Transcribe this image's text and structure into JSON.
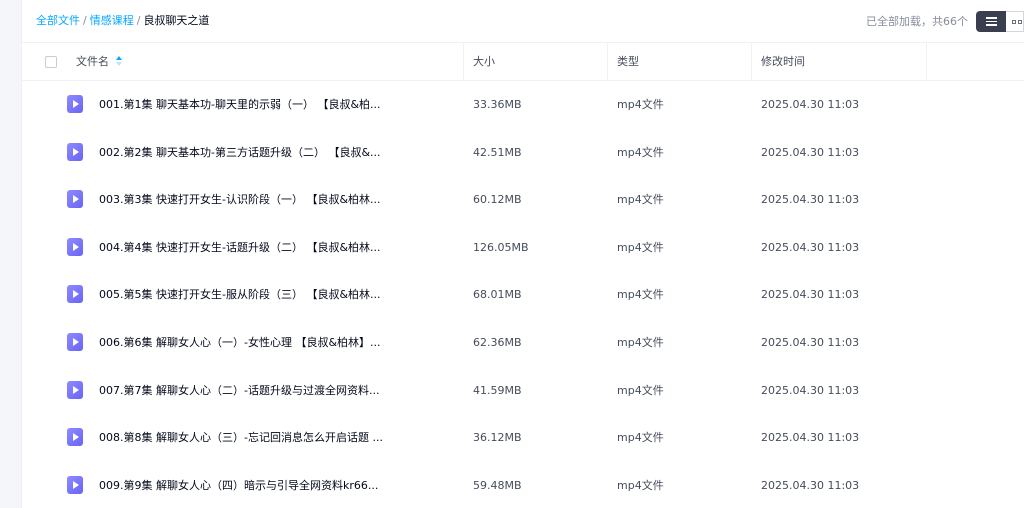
{
  "breadcrumb": {
    "items": [
      "全部文件",
      "情感课程"
    ],
    "separator": "/",
    "current": "良叔聊天之道"
  },
  "status": {
    "load_text": "已全部加载，共66个"
  },
  "view_toggle": {
    "active": "list-icon",
    "inactive": "grid-icon"
  },
  "table": {
    "columns": {
      "name": "文件名",
      "size": "大小",
      "type": "类型",
      "modified": "修改时间"
    },
    "rows": [
      {
        "name": "001.第1集 聊天基本功-聊天里的示弱（一） 【良叔&柏...",
        "size": "33.36MB",
        "type": "mp4文件",
        "modified": "2025.04.30 11:03"
      },
      {
        "name": "002.第2集 聊天基本功-第三方话题升级（二） 【良叔&...",
        "size": "42.51MB",
        "type": "mp4文件",
        "modified": "2025.04.30 11:03"
      },
      {
        "name": "003.第3集 快速打开女生-认识阶段（一） 【良叔&柏林...",
        "size": "60.12MB",
        "type": "mp4文件",
        "modified": "2025.04.30 11:03"
      },
      {
        "name": "004.第4集 快速打开女生-话题升级（二） 【良叔&柏林...",
        "size": "126.05MB",
        "type": "mp4文件",
        "modified": "2025.04.30 11:03"
      },
      {
        "name": "005.第5集 快速打开女生-服从阶段（三） 【良叔&柏林...",
        "size": "68.01MB",
        "type": "mp4文件",
        "modified": "2025.04.30 11:03"
      },
      {
        "name": "006.第6集 解聊女人心（一）-女性心理 【良叔&柏林】...",
        "size": "62.36MB",
        "type": "mp4文件",
        "modified": "2025.04.30 11:03"
      },
      {
        "name": "007.第7集 解聊女人心（二）-话题升级与过渡全网资料...",
        "size": "41.59MB",
        "type": "mp4文件",
        "modified": "2025.04.30 11:03"
      },
      {
        "name": "008.第8集 解聊女人心（三）-忘记回消息怎么开启话题 ...",
        "size": "36.12MB",
        "type": "mp4文件",
        "modified": "2025.04.30 11:03"
      },
      {
        "name": "009.第9集 解聊女人心（四）暗示与引导全网资料kr66...",
        "size": "59.48MB",
        "type": "mp4文件",
        "modified": "2025.04.30 11:03"
      }
    ]
  },
  "colors": {
    "accent": "#06a7ff",
    "file_icon": "#7b76fa",
    "text_primary": "#03081a",
    "text_secondary": "#878c9c"
  }
}
